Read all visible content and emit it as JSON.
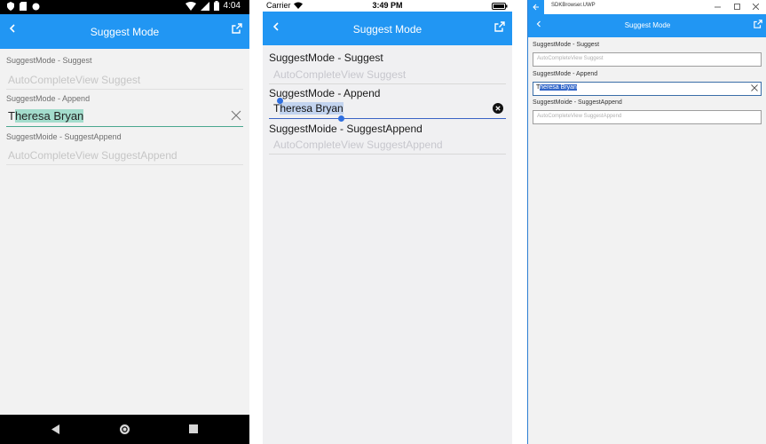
{
  "android": {
    "status": {
      "time": "4:04"
    },
    "appbar": {
      "title": "Suggest Mode"
    },
    "fields": [
      {
        "label": "SuggestMode - Suggest",
        "placeholder": "AutoCompleteView Suggest"
      },
      {
        "label": "SuggestMode - Append",
        "value_typed": "T",
        "value_selected": "heresa Bryan"
      },
      {
        "label": "SuggestMoide - SuggestAppend",
        "placeholder": "AutoCompleteView SuggestAppend"
      }
    ]
  },
  "ios": {
    "status": {
      "carrier": "Carrier",
      "time": "3:49 PM"
    },
    "appbar": {
      "title": "Suggest Mode"
    },
    "fields": [
      {
        "label": "SuggestMode - Suggest",
        "placeholder": "AutoCompleteView Suggest"
      },
      {
        "label": "SuggestMode - Append",
        "value_typed": "T",
        "value_selected": "heresa Bryan"
      },
      {
        "label": "SuggestMoide - SuggestAppend",
        "placeholder": "AutoCompleteView SuggestAppend"
      }
    ]
  },
  "uwp": {
    "window": {
      "title": "SDKBrowser.UWP"
    },
    "appbar": {
      "title": "Suggest Mode"
    },
    "fields": [
      {
        "label": "SuggestMode - Suggest",
        "placeholder": "AutoCompleteView Suggest"
      },
      {
        "label": "SuggestMode - Append",
        "value_typed": "T",
        "value_selected": "heresa Bryan"
      },
      {
        "label": "SuggestMoide - SuggestAppend",
        "placeholder": "AutoCompleteView SuggestAppend"
      }
    ]
  },
  "colors": {
    "accent": "#2196f3",
    "android_highlight": "#a3dccc",
    "ios_highlight": "#c3d4ef",
    "uwp_highlight": "#3367c9"
  },
  "icons": [
    "back-arrow-icon",
    "external-link-icon",
    "clear-icon",
    "wifi-icon",
    "signal-icon",
    "battery-icon",
    "nav-back-icon",
    "nav-home-icon",
    "nav-recents-icon"
  ]
}
